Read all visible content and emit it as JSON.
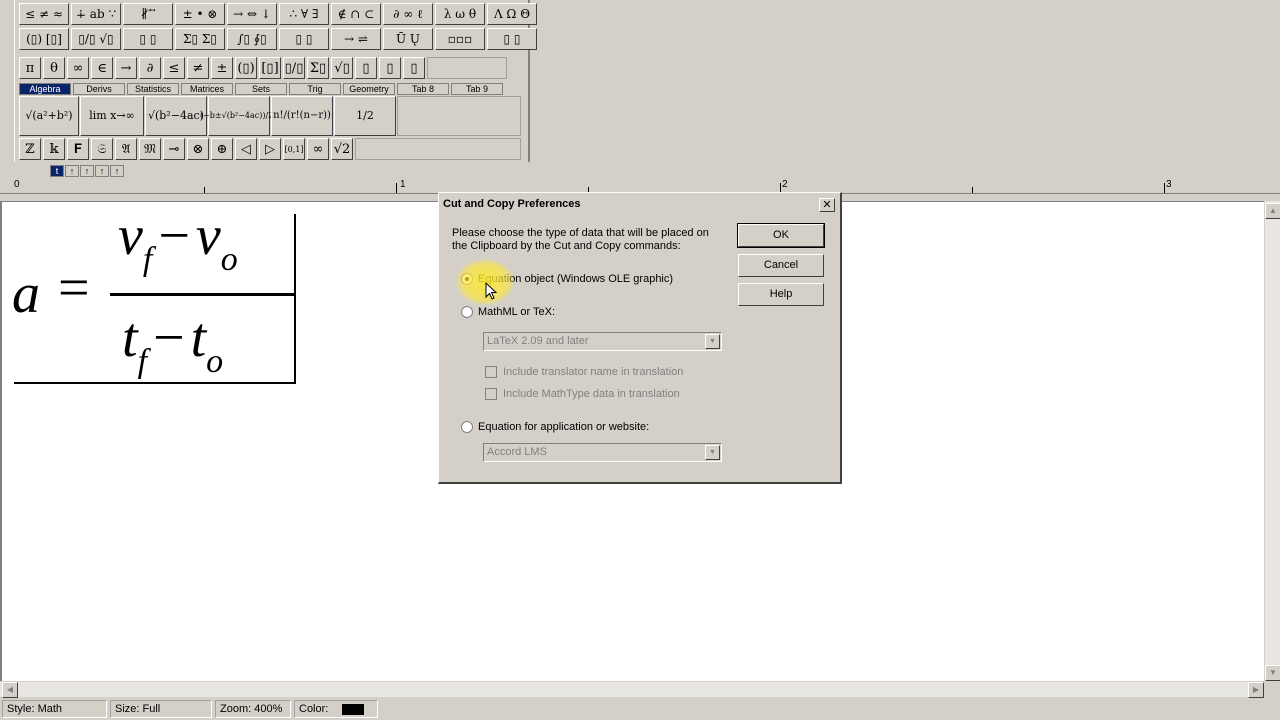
{
  "toolbar": {
    "row1": [
      "≤ ≠ ≈",
      "∔ ab ∵",
      "∦ ⃗ ⃗",
      "± • ⊗",
      "→ ⇔ ↓",
      "∴ ∀ ∃",
      "∉ ∩ ⊂",
      "∂ ∞ ℓ",
      "λ ω θ",
      "Λ Ω Θ"
    ],
    "row2": [
      "(▯) [▯]",
      "▯/▯ √▯",
      "▯ ▯",
      "Σ▯ Σ▯",
      "∫▯ ∮▯",
      "▯ ▯",
      "→ ⇌",
      "Ū Ų",
      "▫▫▫",
      "▯ ▯"
    ],
    "row3": [
      "π",
      "θ",
      "∞",
      "∈",
      "→",
      "∂",
      "≤",
      "≠",
      "±",
      "(▯)",
      "[▯]",
      "▯/▯",
      "Σ▯",
      "√▯",
      "▯",
      "▯",
      "▯"
    ],
    "tabs": [
      "Algebra",
      "Derivs",
      "Statistics",
      "Matrices",
      "Sets",
      "Trig",
      "Geometry",
      "Tab 8",
      "Tab 9"
    ],
    "templates": [
      "√(a²+b²)",
      "lim x→∞",
      "√(b²−4ac)",
      "(−b±√(b²−4ac))/2a",
      "n!/(r!(n−r))",
      "1/2"
    ],
    "row5": [
      "ℤ",
      "𝕜",
      "𝐅",
      "𝔖",
      "𝔄",
      "𝔐",
      "⊸",
      "⊗",
      "⊕",
      "◁",
      "▷",
      "[0,1]",
      "∞",
      "√2"
    ],
    "subtools": [
      "t",
      "↑",
      "↑",
      "↑",
      "↑"
    ]
  },
  "ruler": {
    "labels": [
      "0",
      "1",
      "2",
      "3"
    ]
  },
  "equation": {
    "lhs": "a",
    "equals": "=",
    "num_v1": "v",
    "num_sub1": "f",
    "num_v2": "v",
    "num_sub2": "o",
    "den_t1": "t",
    "den_sub1": "f",
    "den_t2": "t",
    "den_sub2": "o",
    "minus": "−"
  },
  "dialog": {
    "title": "Cut and Copy Preferences",
    "close": "✕",
    "instructions": "Please choose the type of data that will be placed on the Clipboard by the Cut and Copy commands:",
    "ok": "OK",
    "cancel": "Cancel",
    "help": "Help",
    "option1": "Equation object (Windows OLE graphic)",
    "option2": "MathML or TeX:",
    "option2_select": "LaTeX 2.09 and later",
    "check1": "Include translator name in translation",
    "check2": "Include MathType data in translation",
    "option3": "Equation for application or website:",
    "option3_select": "Accord LMS"
  },
  "status": {
    "style": "Style: Math",
    "size": "Size: Full",
    "zoom": "Zoom: 400%",
    "color": "Color:"
  },
  "colors": {
    "title_tab_active": "#0a246a",
    "face": "#d4d0c8",
    "highlight": "#ffeb28"
  }
}
